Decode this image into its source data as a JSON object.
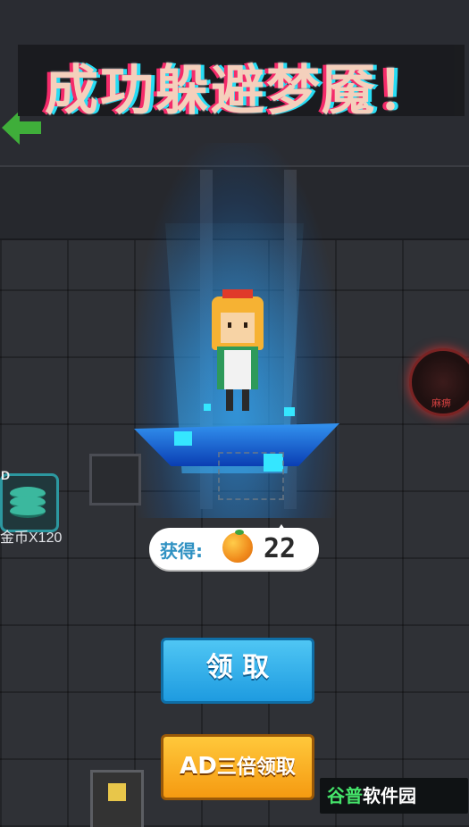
{
  "banner": {
    "title": "成功躲避梦魇！"
  },
  "reward": {
    "label": "获得:",
    "item_icon": "orange-icon",
    "amount": "22"
  },
  "side_reward": {
    "badge": "D",
    "label": "金币X120",
    "icon": "coin-stack-icon"
  },
  "enemy": {
    "status": "麻痹",
    "icon": "demon-sigil-icon"
  },
  "buttons": {
    "claim": "领 取",
    "ad_prefix": "AD",
    "ad_claim": "三倍领取"
  },
  "watermark": {
    "part1": "谷普",
    "part2": "软件园"
  },
  "colors": {
    "primary_button": "#1e9be0",
    "ad_button": "#f59a11",
    "beam": "#35e6ff"
  }
}
